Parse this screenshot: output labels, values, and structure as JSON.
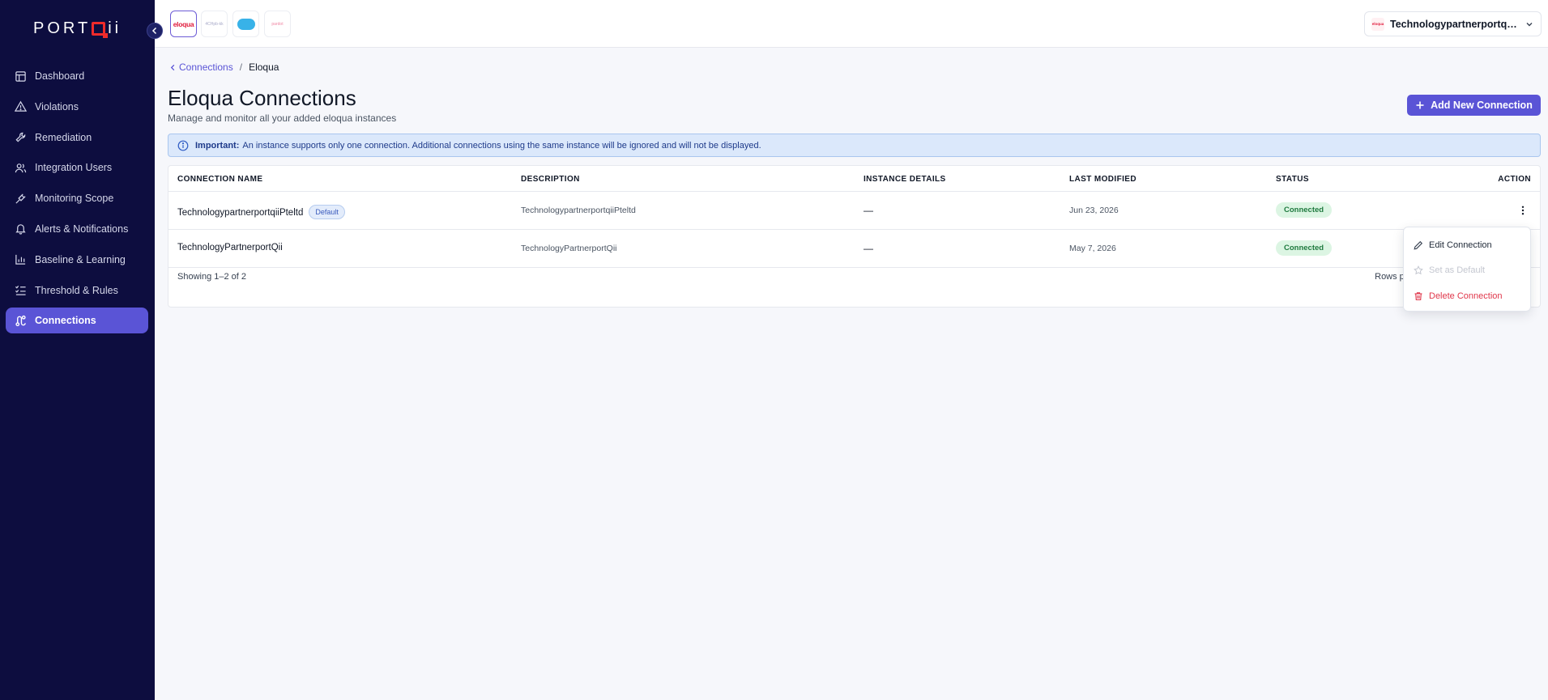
{
  "brand": {
    "name_left": "PORT",
    "name_right": "ii",
    "accent": "#ef2b2b"
  },
  "sidebar": {
    "items": [
      {
        "label": "Dashboard",
        "icon": "layout-icon"
      },
      {
        "label": "Violations",
        "icon": "warning-triangle-icon"
      },
      {
        "label": "Remediation",
        "icon": "wrench-icon"
      },
      {
        "label": "Integration Users",
        "icon": "users-icon"
      },
      {
        "label": "Monitoring Scope",
        "icon": "plug-icon"
      },
      {
        "label": "Alerts & Notifications",
        "icon": "bell-icon"
      },
      {
        "label": "Baseline & Learning",
        "icon": "bar-chart-icon"
      },
      {
        "label": "Threshold & Rules",
        "icon": "list-checks-icon"
      },
      {
        "label": "Connections",
        "icon": "route-icon",
        "active": true
      }
    ]
  },
  "topbar": {
    "apps": [
      {
        "name": "eloqua",
        "label": "eloqua",
        "active": true
      },
      {
        "name": "hubspot-style",
        "label": "4CHpb-kk"
      },
      {
        "name": "salesforce",
        "label": "salesforce"
      },
      {
        "name": "pardot",
        "label": "pardot"
      }
    ],
    "account": {
      "logo_text": "eloqua",
      "name": "Technologypartnerportqii..."
    }
  },
  "breadcrumb": {
    "parent": "Connections",
    "separator": "/",
    "current": "Eloqua"
  },
  "page": {
    "title": "Eloqua Connections",
    "subtitle": "Manage and monitor all your added eloqua instances",
    "add_button": "Add New Connection"
  },
  "alert": {
    "strong": "Important:",
    "text": "An instance supports only one connection. Additional connections using the same instance will be ignored and will not be displayed."
  },
  "table": {
    "headers": {
      "name": "CONNECTION NAME",
      "description": "DESCRIPTION",
      "instance": "INSTANCE DETAILS",
      "modified": "LAST MODIFIED",
      "status": "STATUS",
      "action": "ACTION"
    },
    "rows": [
      {
        "name": "TechnologypartnerportqiiPteltd",
        "badge": "Default",
        "description": "TechnologypartnerportqiiPteltd",
        "instance": "—",
        "modified": "Jun 23, 2026",
        "status": "Connected"
      },
      {
        "name": "TechnologyPartnerportQii",
        "badge": "",
        "description": "TechnologyPartnerportQii",
        "instance": "—",
        "modified": "May 7, 2026",
        "status": "Connected"
      }
    ],
    "footer": {
      "showing": "Showing 1–2 of 2",
      "rows_per_page": "Rows per pag"
    }
  },
  "action_menu": {
    "items": [
      {
        "label": "Edit Connection",
        "icon": "pencil-icon",
        "state": "normal"
      },
      {
        "label": "Set as Default",
        "icon": "star-icon",
        "state": "disabled"
      },
      {
        "label": "Delete Connection",
        "icon": "trash-icon",
        "state": "danger"
      }
    ]
  },
  "colors": {
    "sidebar_bg": "#0d0d3f",
    "primary": "#5a54d6",
    "success_bg": "#dcf5e3",
    "success_text": "#1f7a3f",
    "danger": "#e0364a",
    "info_bg": "#dbe8fb"
  }
}
